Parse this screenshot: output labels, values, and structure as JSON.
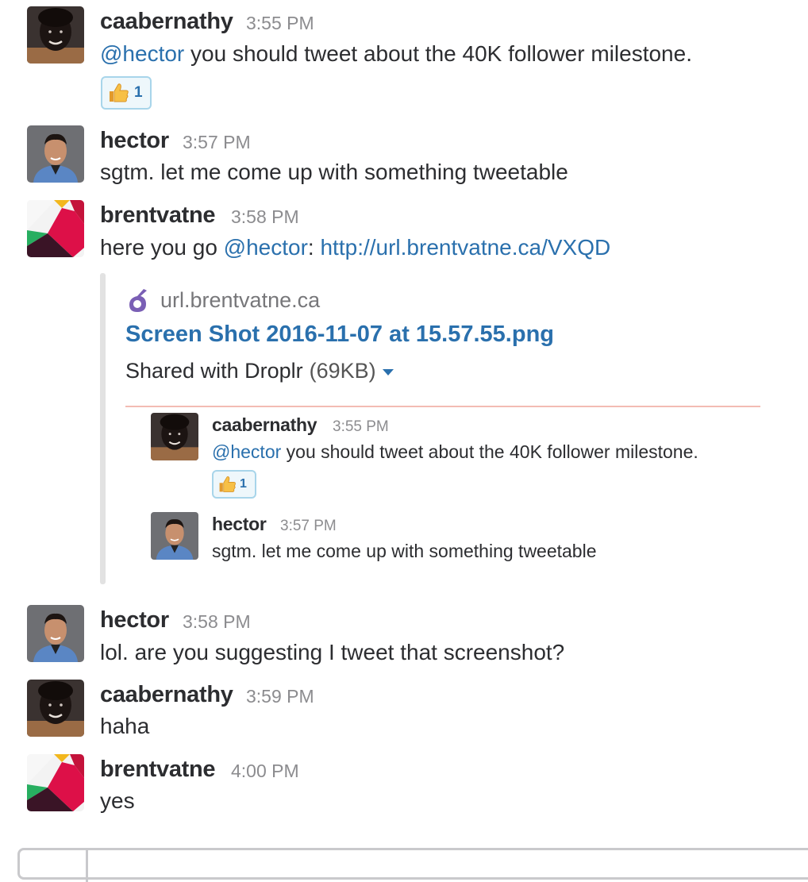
{
  "messages": [
    {
      "user": "caabernathy",
      "time": "3:55 PM",
      "mention": "@hector",
      "text": " you should tweet about the 40K follower milestone.",
      "reaction": {
        "emoji": "thumbs-up",
        "count": "1"
      }
    },
    {
      "user": "hector",
      "time": "3:57 PM",
      "text": "sgtm. let me come up with something tweetable"
    },
    {
      "user": "brentvatne",
      "time": "3:58 PM",
      "prefix": "here you go ",
      "mention": "@hector",
      "separator": ": ",
      "link": "http://url.brentvatne.ca/VXQD"
    },
    {
      "user": "hector",
      "time": "3:58 PM",
      "text": "lol. are you suggesting I tweet that screenshot?"
    },
    {
      "user": "caabernathy",
      "time": "3:59 PM",
      "text": "haha"
    },
    {
      "user": "brentvatne",
      "time": "4:00 PM",
      "text": "yes"
    }
  ],
  "attachment": {
    "service": "url.brentvatne.ca",
    "service_icon": "droplr-icon",
    "title": "Screen Shot 2016-11-07 at 15.57.55.png",
    "description": "Shared with Droplr",
    "size": "(69KB)",
    "accent_color": "#f3bcb3",
    "quoted": [
      {
        "user": "caabernathy",
        "time": "3:55 PM",
        "mention": "@hector",
        "text": " you should tweet about the 40K follower milestone.",
        "reaction": {
          "emoji": "thumbs-up",
          "count": "1"
        }
      },
      {
        "user": "hector",
        "time": "3:57 PM",
        "text": "sgtm. let me come up with something tweetable"
      }
    ]
  },
  "colors": {
    "link": "#2a70ad",
    "text": "#2c2d30",
    "timestamp": "#8c8c8f",
    "reaction_border": "#a8d5ea"
  }
}
